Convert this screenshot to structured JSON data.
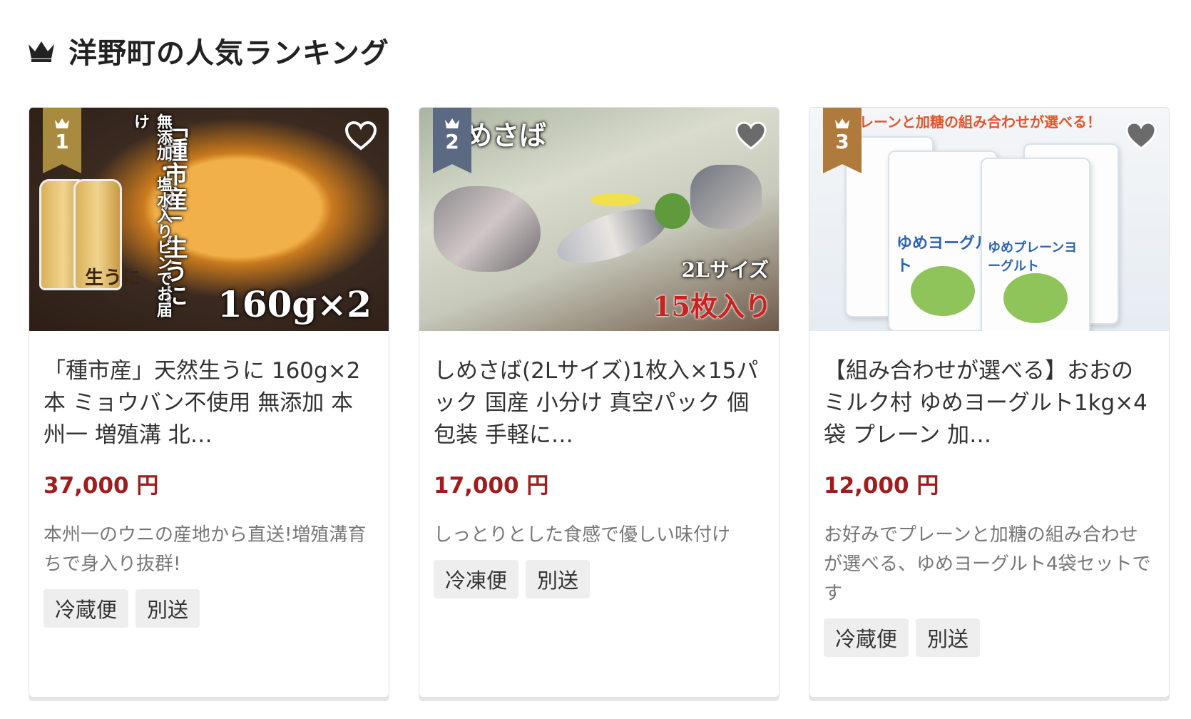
{
  "section": {
    "title": "洋野町の人気ランキング",
    "crown_icon": "crown-icon"
  },
  "colors": {
    "price": "#a11d1d",
    "rank_1": "#a98b3f",
    "rank_2": "#5b6a82",
    "rank_3": "#b07a3d"
  },
  "products": [
    {
      "rank": "1",
      "name": "「種市産」天然生うに 160g×2本 ミョウバン不使用 無添加 本州一 増殖溝 北…",
      "price": "37,000 円",
      "description": "本州一のウニの産地から直送!増殖溝育ちで身入り抜群!",
      "tags": [
        "冷蔵便",
        "別送"
      ],
      "image_text": {
        "vertical_1": "「種市産」生うに",
        "vertical_2": "無添加・塩水入りビンでお届け",
        "bottom": "160g×2",
        "jar_label": "生うに"
      }
    },
    {
      "rank": "2",
      "name": "しめさば(2Lサイズ)1枚入×15パック 国産 小分け 真空パック 個包装 手軽に…",
      "price": "17,000 円",
      "description": "しっとりとした食感で優しい味付け",
      "tags": [
        "冷凍便",
        "別送"
      ],
      "image_text": {
        "top": "めさば",
        "size": "2Lサイズ",
        "count": "15枚入り"
      }
    },
    {
      "rank": "3",
      "name": "【組み合わせが選べる】おおのミルク村 ゆめヨーグルト1kg×4袋 プレーン 加…",
      "price": "12,000 円",
      "description": "お好みでプレーンと加糖の組み合わせが選べる、ゆめヨーグルト4袋セットです",
      "tags": [
        "冷蔵便",
        "別送"
      ],
      "image_text": {
        "banner": "レーンと加糖の組み合わせが選べる！",
        "pack_1": "ゆめヨーグルト",
        "pack_2": "ゆめプレーンヨーグルト"
      }
    }
  ]
}
